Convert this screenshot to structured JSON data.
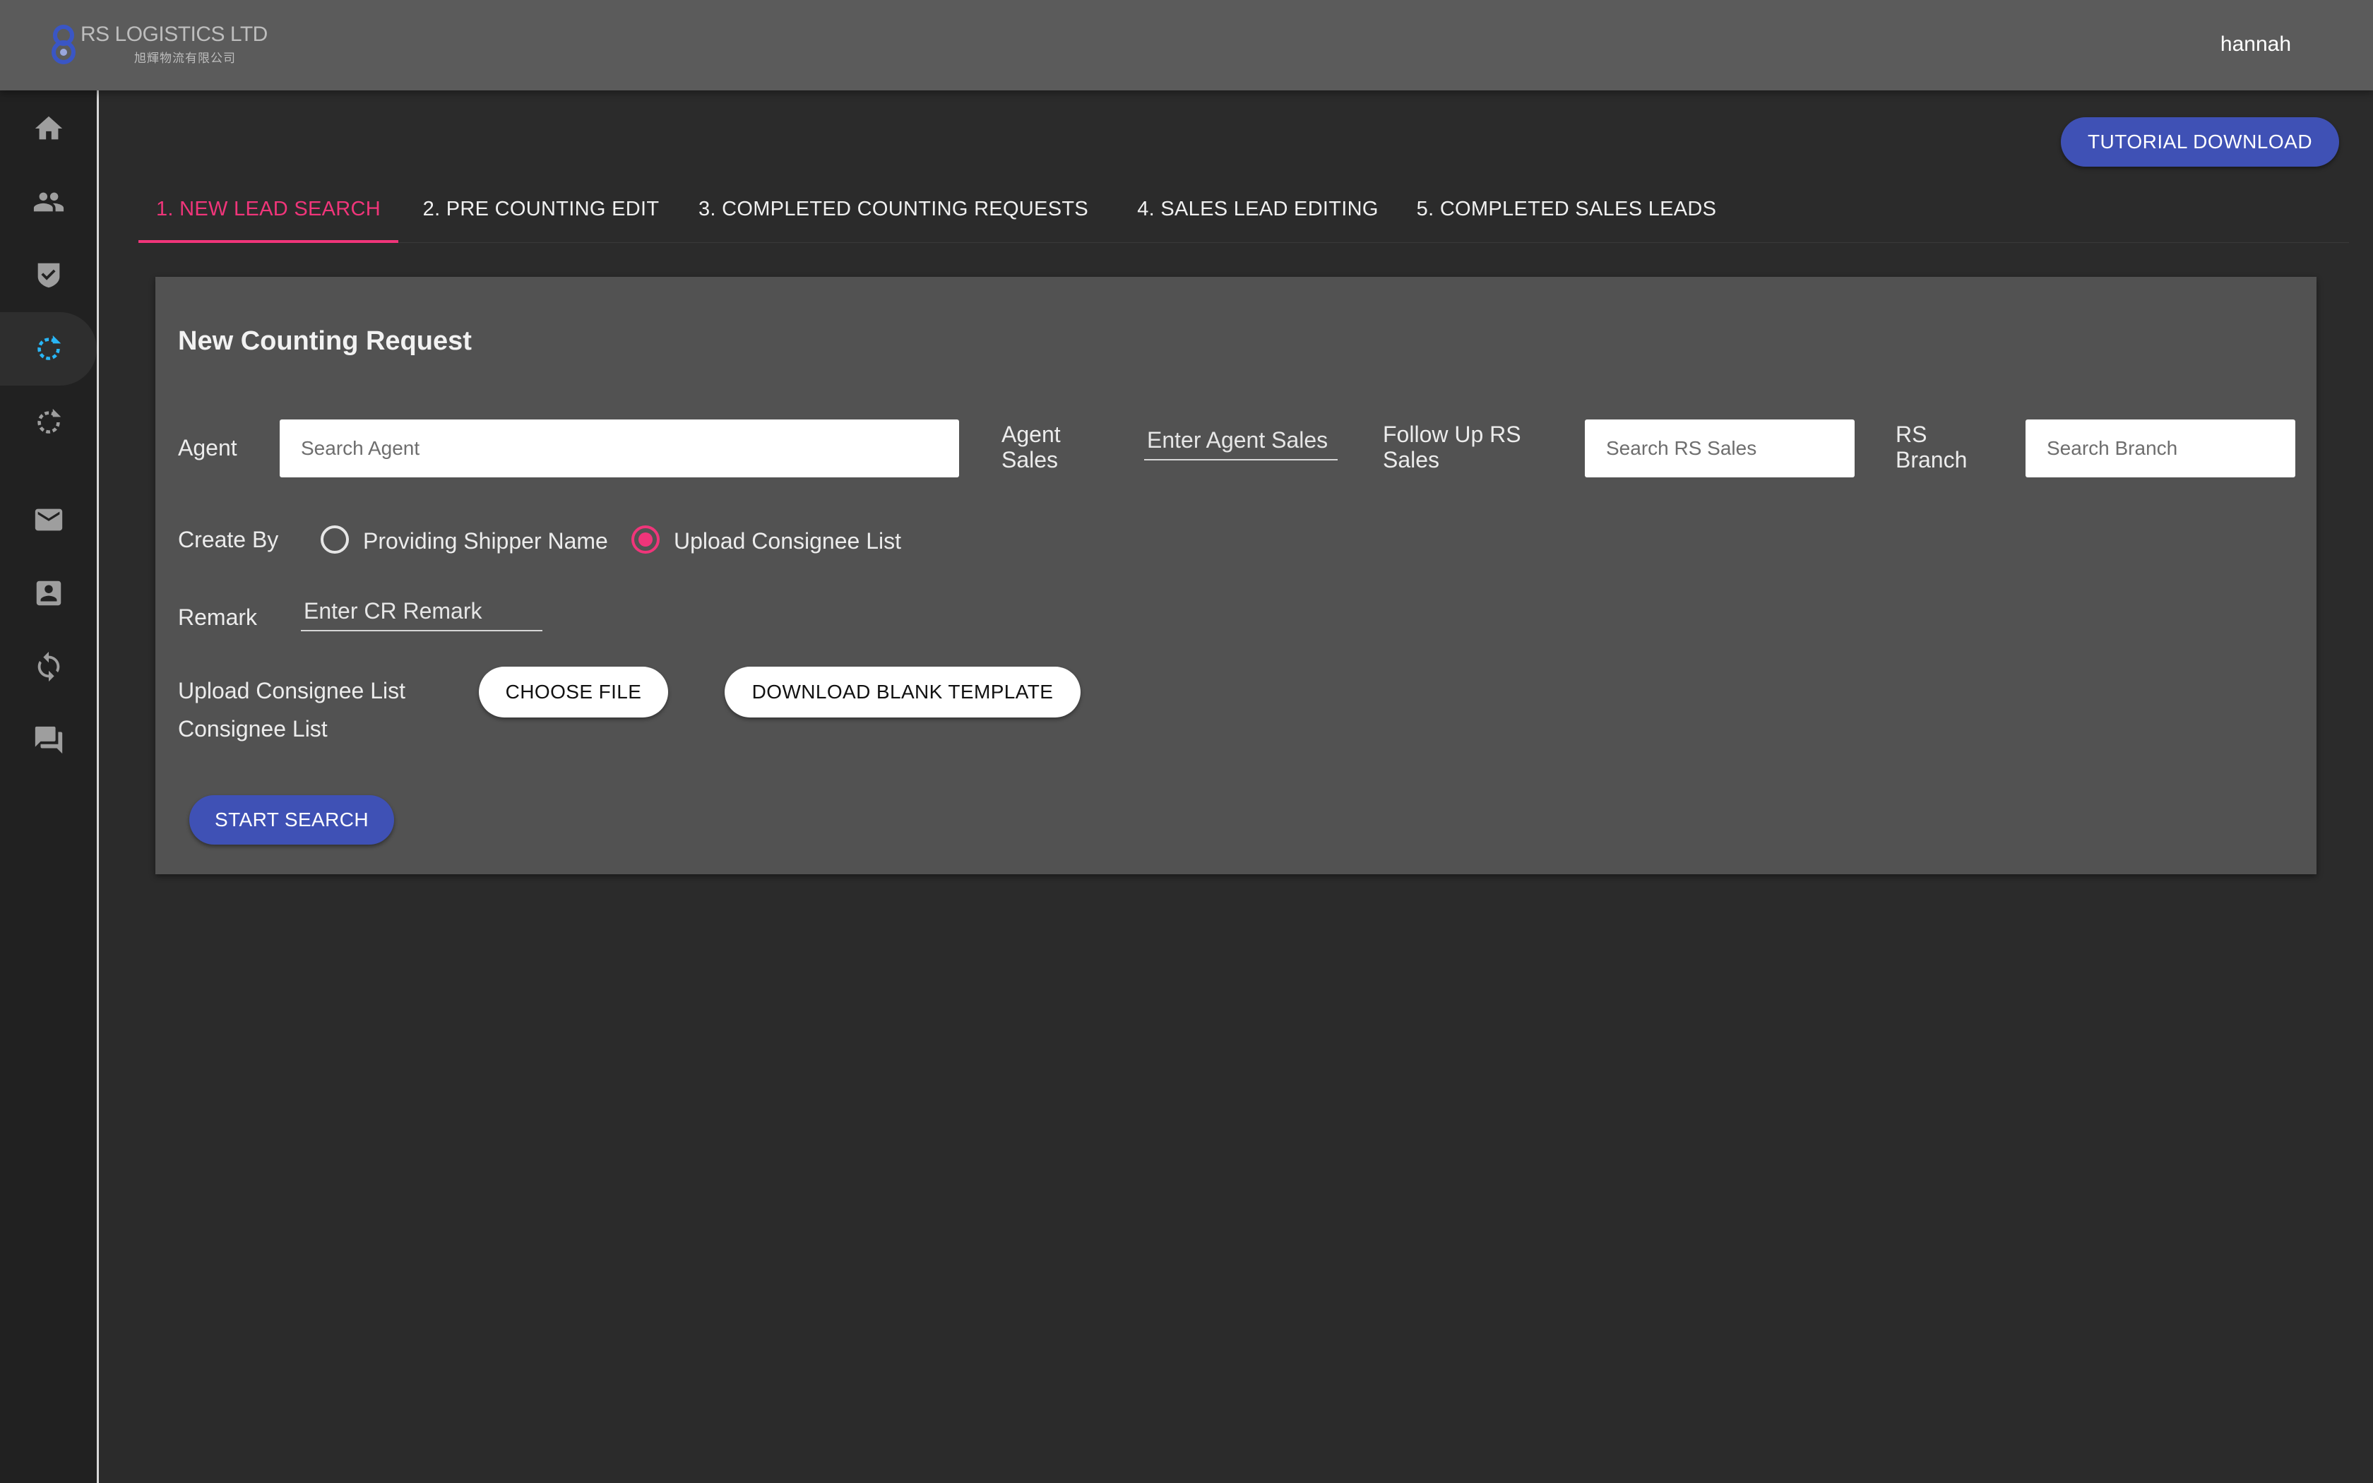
{
  "header": {
    "logo_title": "RS LOGISTICS LTD",
    "logo_subtitle": "旭輝物流有限公司",
    "username": "hannah"
  },
  "sidebar": {
    "items": [
      {
        "icon": "home-icon"
      },
      {
        "icon": "people-icon"
      },
      {
        "icon": "check-shield-icon"
      },
      {
        "icon": "refresh-progress-icon",
        "active": true
      },
      {
        "icon": "refresh-progress-icon"
      },
      {
        "icon": "mail-icon"
      },
      {
        "icon": "contact-card-icon"
      },
      {
        "icon": "sync-icon"
      },
      {
        "icon": "forum-icon"
      }
    ],
    "active_color": "#29b6f6"
  },
  "toolbar": {
    "tutorial_label": "TUTORIAL DOWNLOAD"
  },
  "tabs": [
    {
      "label": "1. NEW LEAD SEARCH",
      "active": true
    },
    {
      "label": "2. PRE COUNTING EDIT"
    },
    {
      "label": "3. COMPLETED COUNTING REQUESTS"
    },
    {
      "label": "4. SALES LEAD EDITING"
    },
    {
      "label": "5. COMPLETED SALES LEADS"
    }
  ],
  "form": {
    "title": "New Counting Request",
    "agent": {
      "label": "Agent",
      "placeholder": "Search Agent"
    },
    "agent_sales": {
      "label": "Agent Sales",
      "placeholder": "Enter Agent Sales"
    },
    "follow_up": {
      "label": "Follow Up RS Sales",
      "placeholder": "Search RS Sales"
    },
    "branch": {
      "label": "RS Branch",
      "placeholder": "Search Branch"
    },
    "create_by": {
      "label": "Create By",
      "options": [
        "Providing Shipper Name",
        "Upload Consignee List"
      ],
      "selected": "Upload Consignee List"
    },
    "remark": {
      "label": "Remark",
      "placeholder": "Enter CR Remark"
    },
    "upload": {
      "label": "Upload Consignee List",
      "sublabel": "Consignee List",
      "choose_label": "CHOOSE FILE",
      "template_label": "DOWNLOAD BLANK TEMPLATE"
    },
    "start_label": "START SEARCH"
  },
  "colors": {
    "accent": "#f0357a",
    "primary": "#3f51b5"
  }
}
